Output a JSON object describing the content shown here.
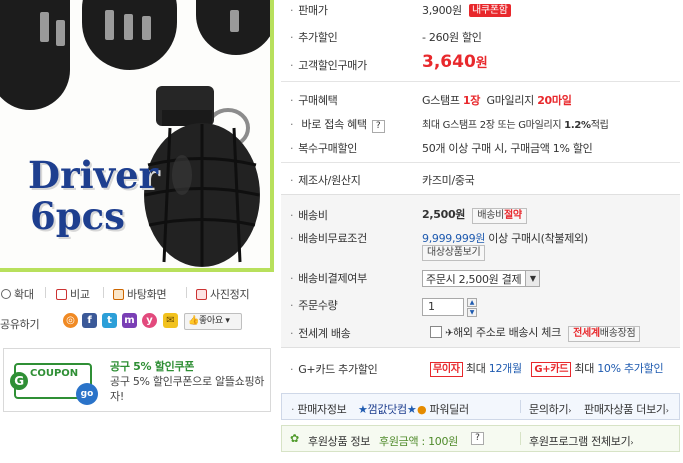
{
  "product_image": {
    "caption_line1": "Driver",
    "caption_line2": "6pcs"
  },
  "image_tools": {
    "zoom": "확대",
    "compare": "비교",
    "wallpaper": "바탕화면",
    "photo": "사진정지"
  },
  "share": {
    "label": "공유하기",
    "like": "좋아요"
  },
  "coupon": {
    "logo_text": "COUPON",
    "logo_go": "go",
    "title": "공구 5% 할인쿠폰",
    "desc": "공구 5% 할인쿠폰으로 알뜰쇼핑하자!"
  },
  "info": {
    "sale_price_label": "판매가",
    "sale_price_value": "3,900원",
    "sale_price_badge": "내쿠폰함",
    "extra_discount_label": "추가할인",
    "extra_discount_value": "- 260원 할인",
    "customer_price_label": "고객할인구매가",
    "customer_price_number": "3,640",
    "customer_price_unit": "원",
    "benefit_label": "구매혜택",
    "benefit_stamp_prefix": "G스탬프 ",
    "benefit_stamp_value": "1장",
    "benefit_mileage_prefix": "G마일리지 ",
    "benefit_mileage_value": "20마일",
    "direct_label": "바로 접속 혜택",
    "direct_value_prefix": "최대 G스탬프 2장 또는 G마일리지 ",
    "direct_value_percent": "1.2%",
    "direct_value_suffix": "적립",
    "multi_label": "복수구매할인",
    "multi_value": "50개 이상 구매 시, 구매금액 1% 할인",
    "maker_label": "제조사/원산지",
    "maker_value": "카즈미/중국",
    "shipping_label": "배송비",
    "shipping_value": "2,500원",
    "shipping_btn_prefix": "배송비",
    "shipping_btn_highlight": "절약",
    "free_ship_label": "배송비무료조건",
    "free_ship_amount": "9,999,999원",
    "free_ship_suffix": " 이상 구매시(착불제외)",
    "free_ship_btn": "대상상품보기",
    "pay_label": "배송비결제여부",
    "pay_select": "주문시 2,500원 결제",
    "qty_label": "주문수량",
    "qty_value": "1",
    "global_label": "전세계 배송",
    "global_value": "해외 주소로 배송시 체크",
    "global_badge": "전세계",
    "global_btn": "배송장점",
    "gcard_label": "G+카드 추가할인",
    "gcard_tag1": "무이자",
    "gcard_text1": "최대 ",
    "gcard_months": "12개월",
    "gcard_tag2": "G+카드",
    "gcard_text2": "최대 ",
    "gcard_rate": "10% 추가할인"
  },
  "seller_bar": {
    "label": "판매자정보",
    "seller_name": "껌값닷컴",
    "grade": "파워딜러",
    "ask": "문의하기",
    "more": "판매자상품 더보기"
  },
  "sponsor_bar": {
    "label": "후원상품 정보",
    "amount_label": "후원금액 : 100원",
    "program": "후원프로그램 전체보기"
  },
  "colors": {
    "accent_red": "#e8282c",
    "green_border": "#b8e05c",
    "link_blue": "#1f5bb0",
    "caption_blue": "#1e3f8f"
  }
}
